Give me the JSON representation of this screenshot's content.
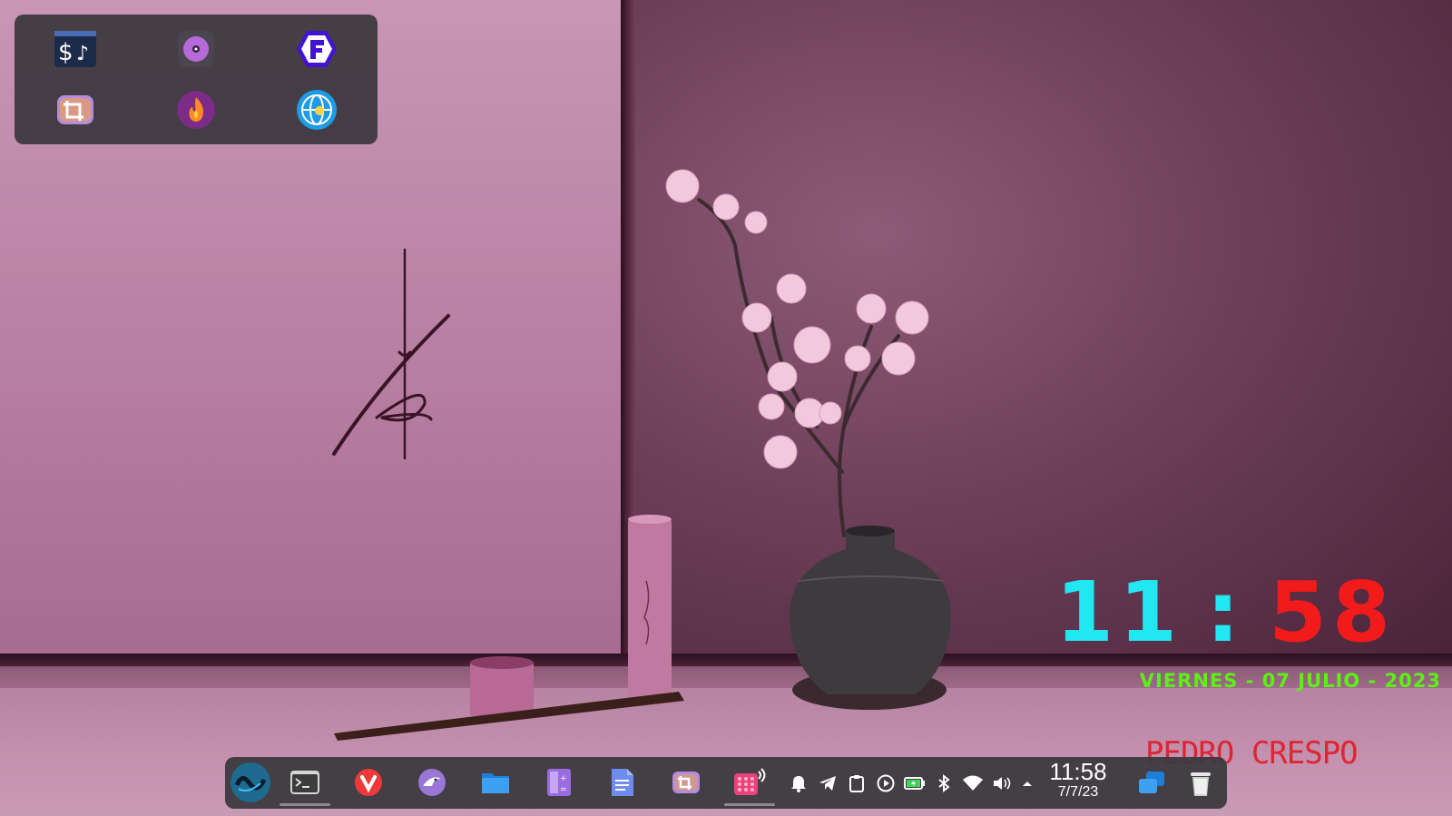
{
  "desktop": {
    "wallpaper": "pink-wall-cherry-blossom-vase",
    "accent_color": "#c797b5"
  },
  "launcher": {
    "apps": [
      {
        "name": "dollar-music-app",
        "icon": "dollar-note-icon"
      },
      {
        "name": "disc-player",
        "icon": "disc-icon"
      },
      {
        "name": "f-app",
        "icon": "f-hexagon-icon"
      },
      {
        "name": "image-crop",
        "icon": "crop-icon"
      },
      {
        "name": "fire-app",
        "icon": "flame-icon"
      },
      {
        "name": "web-globe",
        "icon": "globe-icon"
      }
    ]
  },
  "clock_widget": {
    "hours": "11",
    "separator": ":",
    "minutes": "58",
    "date": "VIERNES - 07 JULIO - 2023",
    "hours_color": "#22e6f0",
    "minutes_color": "#f21b1b",
    "date_color": "#5cf016"
  },
  "owner_label": "PEDRO CRESPO",
  "taskbar": {
    "apps": [
      {
        "name": "start-menu",
        "icon": "logo-icon"
      },
      {
        "name": "terminal",
        "icon": "terminal-icon",
        "active": true
      },
      {
        "name": "vivaldi-browser",
        "icon": "vivaldi-icon"
      },
      {
        "name": "email-client",
        "icon": "eagle-icon"
      },
      {
        "name": "file-manager",
        "icon": "folder-icon"
      },
      {
        "name": "calculator",
        "icon": "calculator-icon"
      },
      {
        "name": "text-editor",
        "icon": "document-icon"
      },
      {
        "name": "screenshot-crop",
        "icon": "crop-icon"
      },
      {
        "name": "audio-app",
        "icon": "speaker-grid-icon",
        "active": true
      }
    ],
    "tray": [
      "bell-icon",
      "telegram-icon",
      "clipboard-icon",
      "play-icon",
      "battery-icon",
      "bluetooth-icon",
      "wifi-icon",
      "volume-icon",
      "chevron-up-icon"
    ],
    "time": "11:58",
    "date": "7/7/23",
    "trailing": [
      "window-switcher-icon",
      "trash-icon"
    ]
  }
}
